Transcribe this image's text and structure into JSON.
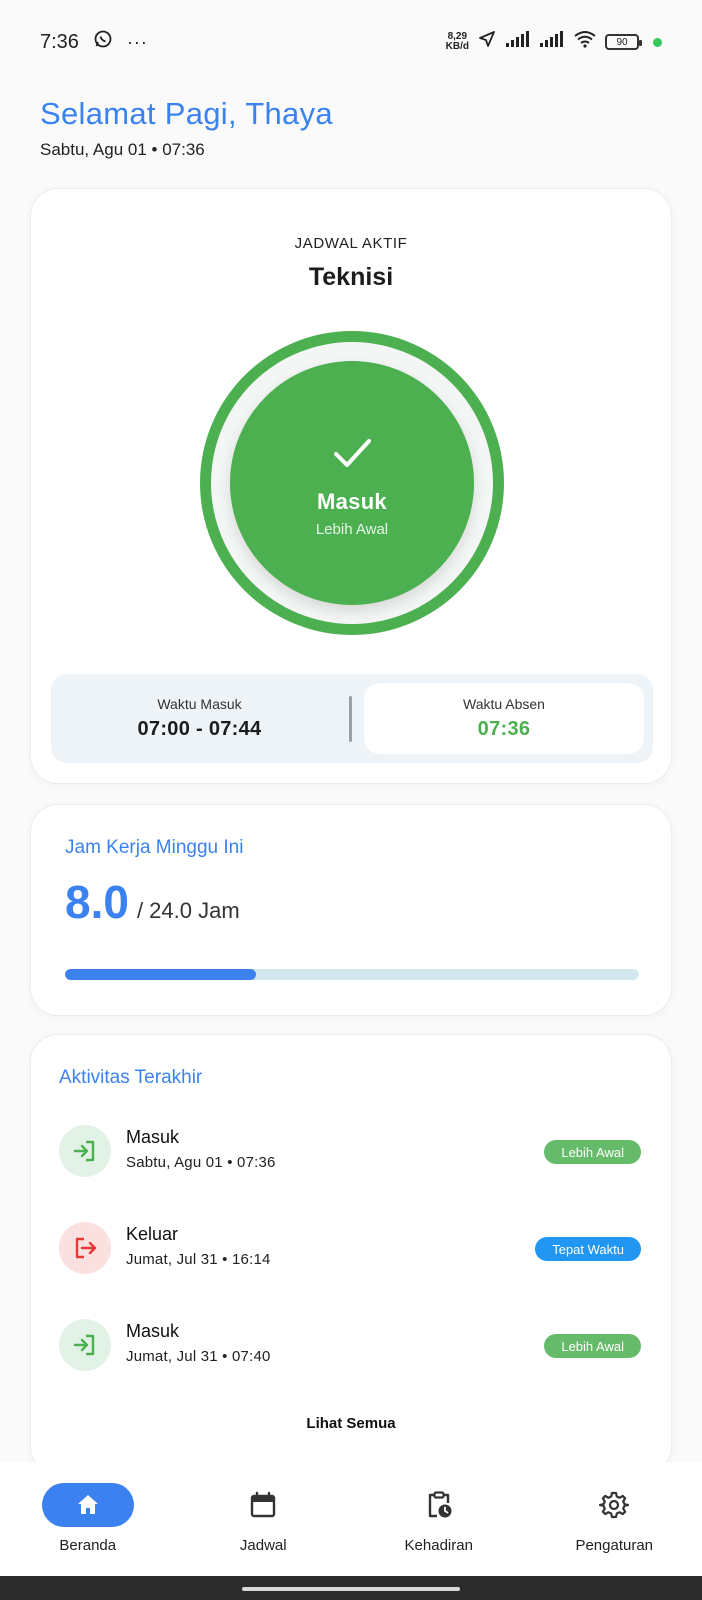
{
  "status_bar": {
    "time": "7:36",
    "net_speed_value": "8,29",
    "net_speed_unit": "KB/d",
    "battery": "90"
  },
  "greeting": {
    "title": "Selamat Pagi, Thaya",
    "date": "Sabtu, Agu 01 • 07:36"
  },
  "schedule": {
    "label": "JADWAL AKTIF",
    "name": "Teknisi",
    "status": "Masuk",
    "status_sub": "Lebih Awal",
    "status_color": "#4caf50",
    "time_in_label": "Waktu Masuk",
    "time_in_value": "07:00 - 07:44",
    "attendance_label": "Waktu Absen",
    "attendance_value": "07:36"
  },
  "work_hours": {
    "title": "Jam Kerja Minggu Ini",
    "value": "8.0",
    "total": "/ 24.0 Jam",
    "progress_fraction": 0.333
  },
  "activities": {
    "title": "Aktivitas Terakhir",
    "items": [
      {
        "type": "in",
        "title": "Masuk",
        "subtitle": "Sabtu, Agu 01 • 07:36",
        "badge": "Lebih Awal",
        "badge_color": "green"
      },
      {
        "type": "out",
        "title": "Keluar",
        "subtitle": "Jumat, Jul 31 • 16:14",
        "badge": "Tepat Waktu",
        "badge_color": "blue"
      },
      {
        "type": "in",
        "title": "Masuk",
        "subtitle": "Jumat, Jul 31 • 07:40",
        "badge": "Lebih Awal",
        "badge_color": "green"
      }
    ],
    "see_all": "Lihat Semua"
  },
  "nav": {
    "items": [
      {
        "label": "Beranda",
        "icon": "home-icon",
        "active": true
      },
      {
        "label": "Jadwal",
        "icon": "calendar-icon",
        "active": false
      },
      {
        "label": "Kehadiran",
        "icon": "clipboard-clock-icon",
        "active": false
      },
      {
        "label": "Pengaturan",
        "icon": "gear-icon",
        "active": false
      }
    ]
  },
  "colors": {
    "accent": "#3b82f0",
    "success": "#4caf50",
    "danger": "#e53935"
  }
}
